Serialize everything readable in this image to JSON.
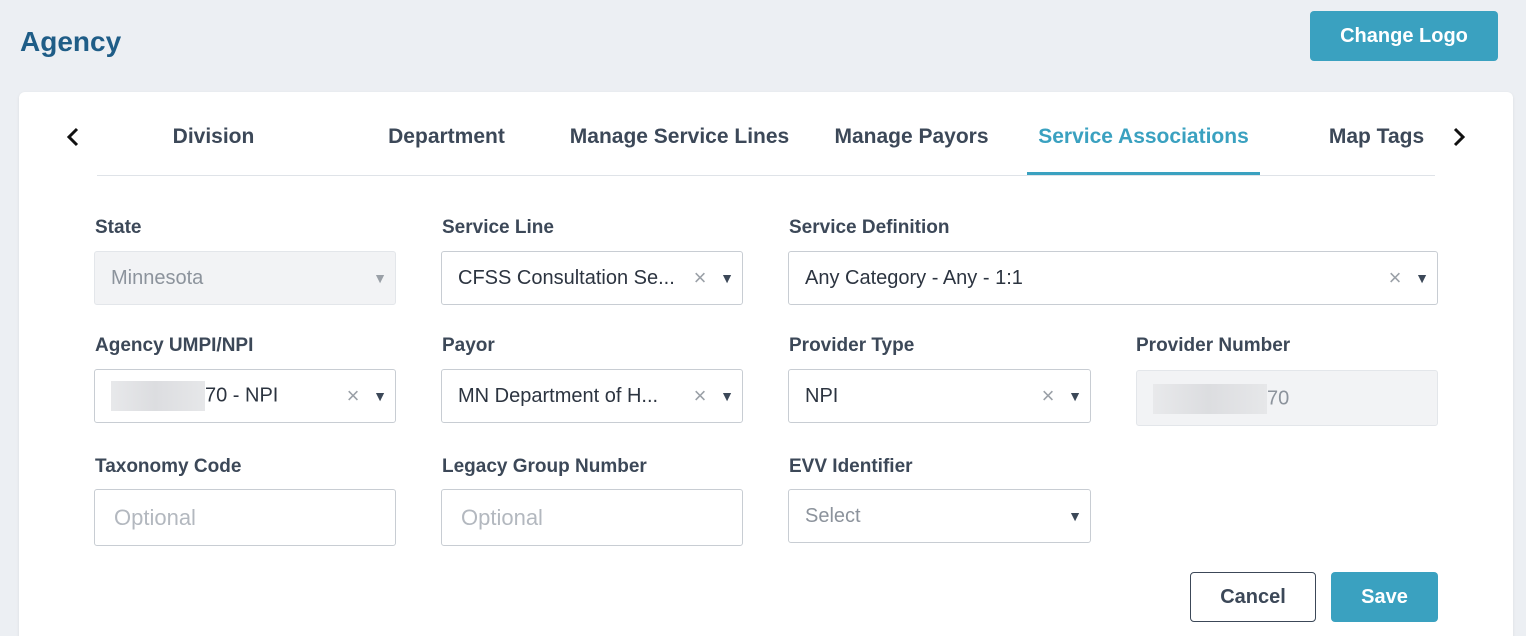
{
  "page": {
    "title": "Agency",
    "change_logo_label": "Change Logo"
  },
  "tabs": [
    {
      "label": "Division",
      "active": false
    },
    {
      "label": "Department",
      "active": false
    },
    {
      "label": "Manage Service Lines",
      "active": false
    },
    {
      "label": "Manage Payors",
      "active": false
    },
    {
      "label": "Service Associations",
      "active": true
    },
    {
      "label": "Map Tags",
      "active": false
    }
  ],
  "form": {
    "state": {
      "label": "State",
      "value": "Minnesota",
      "disabled": true
    },
    "service_line": {
      "label": "Service Line",
      "value": "CFSS Consultation Se..."
    },
    "service_definition": {
      "label": "Service Definition",
      "value": "Any Category - Any - 1:1"
    },
    "agency_npi": {
      "label": "Agency UMPI/NPI",
      "value": "70 - NPI"
    },
    "payor": {
      "label": "Payor",
      "value": "MN Department of H..."
    },
    "provider_type": {
      "label": "Provider Type",
      "value": "NPI"
    },
    "provider_number": {
      "label": "Provider Number",
      "value": "70",
      "disabled": true
    },
    "taxonomy_code": {
      "label": "Taxonomy Code",
      "placeholder": "Optional"
    },
    "legacy_group_number": {
      "label": "Legacy Group Number",
      "placeholder": "Optional"
    },
    "evv_identifier": {
      "label": "EVV Identifier",
      "placeholder": "Select"
    }
  },
  "actions": {
    "cancel_label": "Cancel",
    "save_label": "Save"
  },
  "glyphs": {
    "clear": "×",
    "caret": "▼"
  },
  "colors": {
    "accent": "#3aa1c0",
    "title": "#1f5d87",
    "text": "#3c4858",
    "background": "#eceff3"
  }
}
